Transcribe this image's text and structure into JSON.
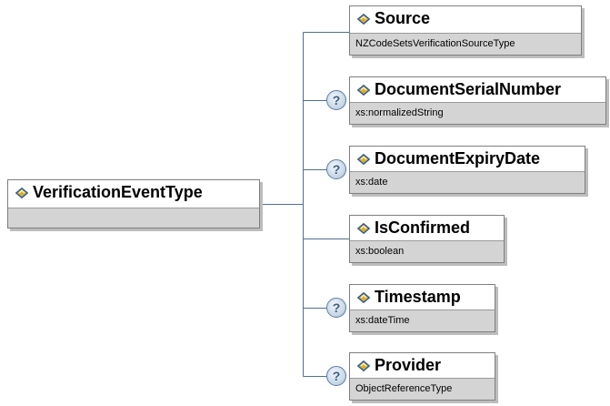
{
  "root": {
    "name": "VerificationEventType"
  },
  "children": [
    {
      "name": "Source",
      "type": "NZCodeSetsVerificationSourceType",
      "optional": false
    },
    {
      "name": "DocumentSerialNumber",
      "type": "xs:normalizedString",
      "optional": true
    },
    {
      "name": "DocumentExpiryDate",
      "type": "xs:date",
      "optional": true
    },
    {
      "name": "IsConfirmed",
      "type": "xs:boolean",
      "optional": false
    },
    {
      "name": "Timestamp",
      "type": "xs:dateTime",
      "optional": true
    },
    {
      "name": "Provider",
      "type": "ObjectReferenceType",
      "optional": true
    }
  ],
  "icons": {
    "element": "element-diamond-icon",
    "optional": "question-mark-icon"
  },
  "optional_glyph": "?",
  "colors": {
    "connector": "#4f6f95",
    "icon_fill": "#d9b030",
    "icon_stroke": "#2b5a99",
    "type_bar": "#d4d4d4"
  }
}
